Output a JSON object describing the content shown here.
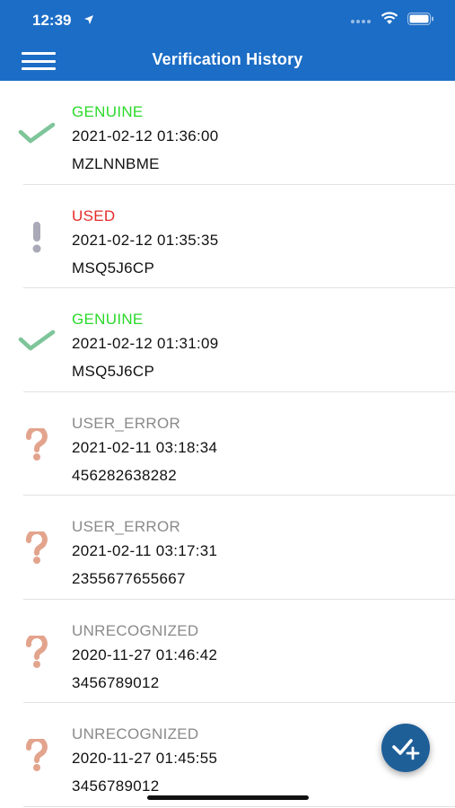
{
  "status_bar": {
    "time": "12:39"
  },
  "header": {
    "title": "Verification History",
    "menu_icon": "hamburger-menu-icon",
    "background_color": "#1c6dc6"
  },
  "colors": {
    "genuine": "#2bd92b",
    "used": "#e52b2b",
    "neutral": "#8a8a8a",
    "check_icon": "#7ec59a",
    "exclaim_icon": "#a9a9b8",
    "question_icon": "#e3a48d",
    "fab": "#1f5f98"
  },
  "history": [
    {
      "status": "GENUINE",
      "status_type": "genuine",
      "icon": "checkmark-icon",
      "datetime": "2021-02-12 01:36:00",
      "code": "MZLNNBME"
    },
    {
      "status": "USED",
      "status_type": "used",
      "icon": "exclamation-icon",
      "datetime": "2021-02-12 01:35:35",
      "code": "MSQ5J6CP"
    },
    {
      "status": "GENUINE",
      "status_type": "genuine",
      "icon": "checkmark-icon",
      "datetime": "2021-02-12 01:31:09",
      "code": "MSQ5J6CP"
    },
    {
      "status": "USER_ERROR",
      "status_type": "gray",
      "icon": "question-mark-icon",
      "datetime": "2021-02-11 03:18:34",
      "code": "456282638282"
    },
    {
      "status": "USER_ERROR",
      "status_type": "gray",
      "icon": "question-mark-icon",
      "datetime": "2021-02-11 03:17:31",
      "code": "2355677655667"
    },
    {
      "status": "UNRECOGNIZED",
      "status_type": "gray",
      "icon": "question-mark-icon",
      "datetime": "2020-11-27 01:46:42",
      "code": "3456789012"
    },
    {
      "status": "UNRECOGNIZED",
      "status_type": "gray",
      "icon": "question-mark-icon",
      "datetime": "2020-11-27 01:45:55",
      "code": "3456789012"
    }
  ],
  "fab": {
    "icon": "check-plus-icon"
  }
}
